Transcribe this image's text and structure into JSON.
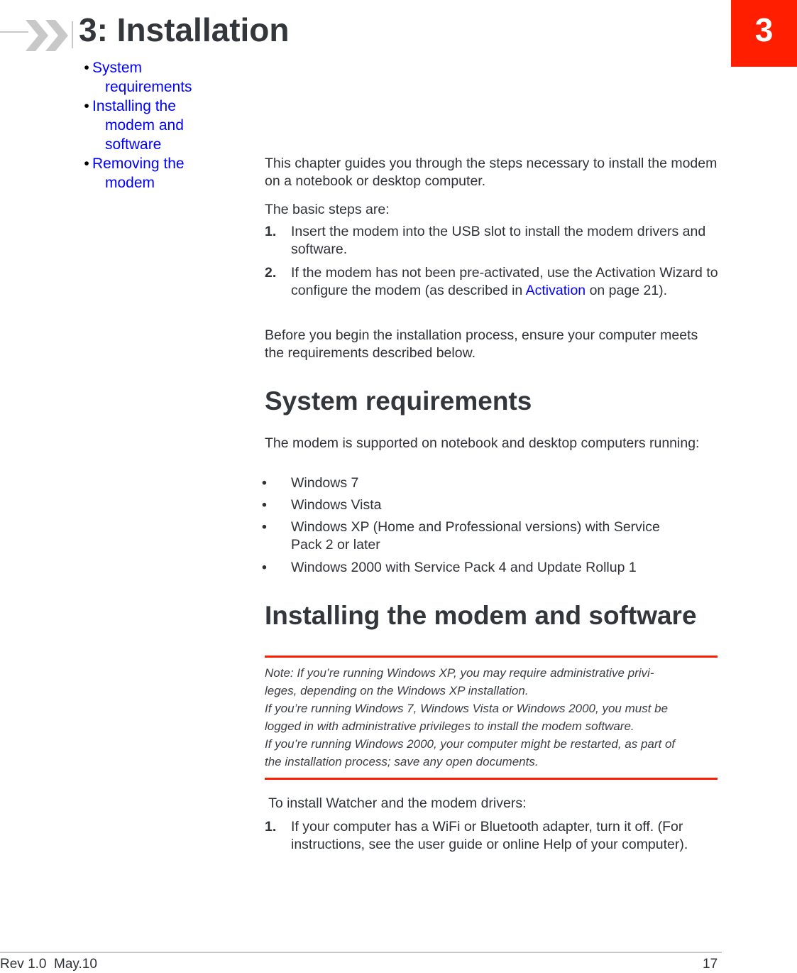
{
  "header": {
    "chapter_title": "3: Installation",
    "chapter_number": "3",
    "accent_color": "#ff1e00"
  },
  "toc": {
    "items": [
      {
        "label_line1": "System",
        "label_line2": "requirements",
        "label_line3": ""
      },
      {
        "label_line1": "Installing the",
        "label_line2": "modem and",
        "label_line3": "software"
      },
      {
        "label_line1": "Removing the",
        "label_line2": "modem",
        "label_line3": ""
      }
    ]
  },
  "intro": {
    "paragraph1": "This chapter guides you through the steps necessary to install the modem on a notebook or desktop computer.",
    "paragraph2": "The basic steps are:",
    "steps": [
      {
        "num": "1.",
        "text": "Insert the modem into the USB slot to install the modem drivers and software."
      },
      {
        "num": "2.",
        "text_before": "If the modem has not been pre-activated, use the Activation Wizard to configure the modem (as described in ",
        "link": "Activation",
        "text_after": " on page 21)."
      }
    ],
    "paragraph3": "Before you begin the installation process, ensure your computer meets the requirements described below."
  },
  "system_requirements": {
    "heading": "System requirements",
    "intro": "The modem is supported on notebook and desktop computers running:",
    "bullet_glyph": "•",
    "items": [
      "Windows 7",
      "Windows Vista",
      "Windows XP (Home and Professional versions) with Service Pack 2 or later",
      "Windows 2000 with Service Pack 4 and Update Rollup 1"
    ]
  },
  "installing": {
    "heading": "Installing the modem and software",
    "note_lines": [
      "Note:  If you’re running Windows XP, you may require administrative privi-",
      "leges, depending on the Windows XP installation.",
      "If you’re running Windows 7, Windows Vista or Windows 2000, you must be",
      "logged in with administrative privileges to install the modem software.",
      "If you’re running Windows 2000, your computer might be restarted, as part of",
      "the installation process; save any open documents."
    ],
    "procedure_intro": " To install Watcher and the modem drivers:",
    "steps": [
      {
        "num": "1.",
        "text": "If your computer has a WiFi or Bluetooth adapter, turn it off. (For instructions, see the user guide or online Help of your computer)."
      }
    ]
  },
  "footer": {
    "revision": "Rev 1.0  May.10",
    "page_number": "17"
  }
}
